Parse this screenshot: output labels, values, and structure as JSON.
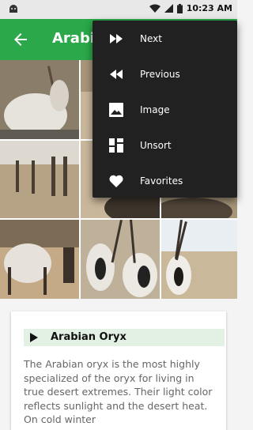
{
  "status_bar": {
    "time": "10:23 AM"
  },
  "app_bar": {
    "title": "Arabian Oryx"
  },
  "menu": {
    "items": [
      {
        "label": "Next",
        "icon": "fast-forward-icon"
      },
      {
        "label": "Previous",
        "icon": "rewind-icon"
      },
      {
        "label": "Image",
        "icon": "image-icon"
      },
      {
        "label": "Unsort",
        "icon": "dashboard-icon"
      },
      {
        "label": "Favorites",
        "icon": "heart-icon"
      }
    ]
  },
  "card": {
    "title": "Arabian Oryx",
    "description": "The Arabian oryx is the most highly specialized of the oryx for living in true desert extremes. Their light color reflects sunlight and the desert heat. On cold winter"
  },
  "colors": {
    "primary": "#2aa84a",
    "menu_bg": "#212121",
    "card_header_bg": "#e3f1e4"
  }
}
